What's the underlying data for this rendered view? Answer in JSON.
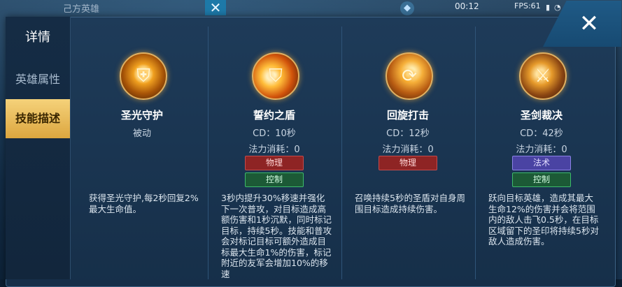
{
  "top": {
    "team_label": "己方英雄",
    "timer": "00:12",
    "fps": "FPS:61",
    "close_glyph": "✕"
  },
  "panel": {
    "tabs_title": "详情",
    "tabs": [
      "英雄属性",
      "技能描述"
    ],
    "active_tab": "技能描述",
    "close_glyph": "✕"
  },
  "skills": [
    {
      "name": "圣光守护",
      "type": "被动",
      "cd": "",
      "cost": "",
      "tags": [],
      "icon": "shield-emblem-icon",
      "desc": "获得圣光守护,每2秒回复2%最大生命值。"
    },
    {
      "name": "誓约之盾",
      "type": "",
      "cd": "CD：10秒",
      "cost": "法力消耗：0",
      "tags": [
        "物理",
        "控制"
      ],
      "icon": "flaming-shield-icon",
      "desc": "3秒内提升30%移速并强化下一次普攻，对目标造成高额伤害和1秒沉默，同时标记目标，持续5秒。技能和普攻会对标记目标可额外造成目标最大生命1%的伤害，标记附近的友军会增加10%的移速"
    },
    {
      "name": "回旋打击",
      "type": "",
      "cd": "CD：12秒",
      "cost": "法力消耗：0",
      "tags": [
        "物理"
      ],
      "icon": "spinning-shield-icon",
      "desc": "召唤持续5秒的圣盾对自身周围目标造成持续伤害。"
    },
    {
      "name": "圣剑裁决",
      "type": "",
      "cd": "CD：42秒",
      "cost": "法力消耗：0",
      "tags": [
        "法术",
        "控制"
      ],
      "icon": "holy-sword-icon",
      "desc": "跃向目标英雄，造成其最大生命12%的伤害并会将范围内的敌人击飞0.5秒，在目标区域留下的圣印将持续5秒对敌人造成伤害。"
    }
  ],
  "colors": {
    "accent_tab": "#e8b550",
    "physical": "#8e2424",
    "magic": "#4a43a3",
    "control": "#1c5a36"
  }
}
